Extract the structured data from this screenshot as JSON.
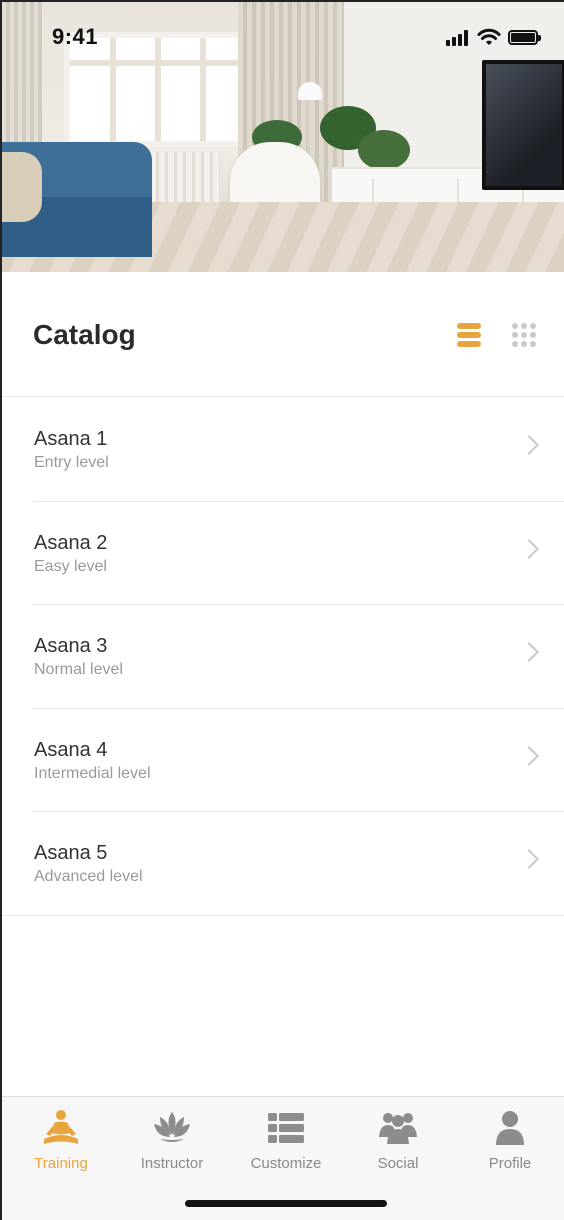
{
  "status_bar": {
    "time": "9:41"
  },
  "catalog": {
    "title": "Catalog",
    "active_view": "list"
  },
  "items": [
    {
      "title": "Asana 1",
      "subtitle": "Entry level"
    },
    {
      "title": "Asana 2",
      "subtitle": "Easy level"
    },
    {
      "title": "Asana 3",
      "subtitle": "Normal level"
    },
    {
      "title": "Asana 4",
      "subtitle": "Intermedial level"
    },
    {
      "title": "Asana 5",
      "subtitle": "Advanced level"
    }
  ],
  "tabs": [
    {
      "label": "Training",
      "icon": "meditation-icon",
      "active": true
    },
    {
      "label": "Instructor",
      "icon": "lotus-icon",
      "active": false
    },
    {
      "label": "Customize",
      "icon": "list-icon",
      "active": false
    },
    {
      "label": "Social",
      "icon": "group-icon",
      "active": false
    },
    {
      "label": "Profile",
      "icon": "person-icon",
      "active": false
    }
  ],
  "colors": {
    "accent": "#e8a53d",
    "inactive": "#8a8a8a",
    "icon_inactive": "#8c8c8c"
  }
}
